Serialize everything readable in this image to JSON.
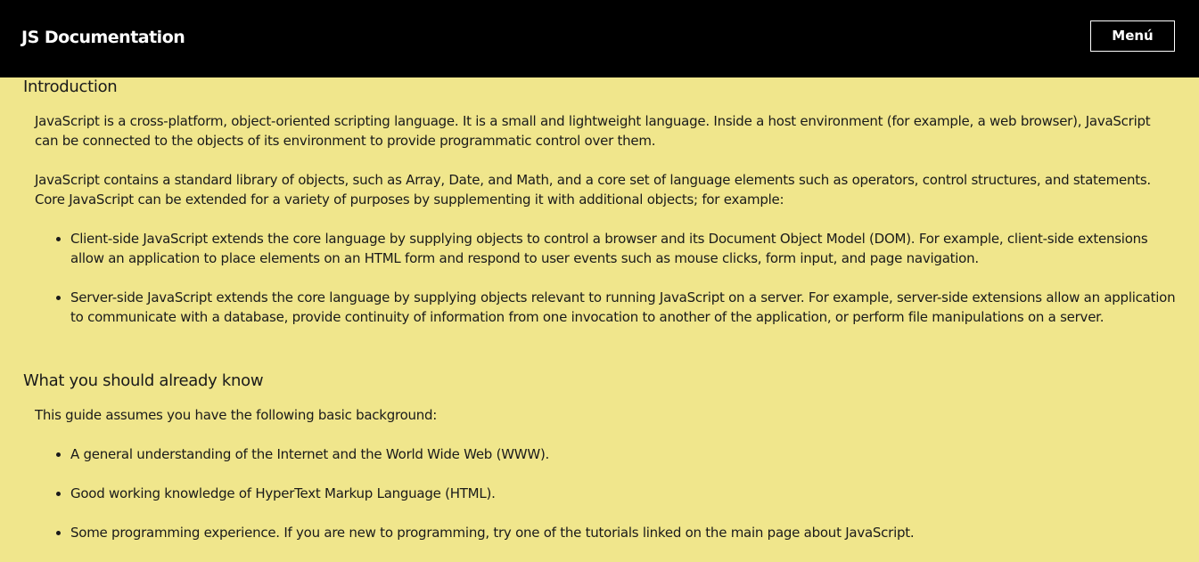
{
  "navbar": {
    "brand": "JS Documentation",
    "menu_label": "Menú"
  },
  "sections": {
    "introduction": {
      "heading": "Introduction",
      "paragraphs": [
        "JavaScript is a cross-platform, object-oriented scripting language. It is a small and lightweight language. Inside a host environment (for example, a web browser), JavaScript can be connected to the objects of its environment to provide programmatic control over them.",
        "JavaScript contains a standard library of objects, such as Array, Date, and Math, and a core set of language elements such as operators, control structures, and statements. Core JavaScript can be extended for a variety of purposes by supplementing it with additional objects; for example:"
      ],
      "list": [
        "Client-side JavaScript extends the core language by supplying objects to control a browser and its Document Object Model (DOM). For example, client-side extensions allow an application to place elements on an HTML form and respond to user events such as mouse clicks, form input, and page navigation.",
        "Server-side JavaScript extends the core language by supplying objects relevant to running JavaScript on a server. For example, server-side extensions allow an application to communicate with a database, provide continuity of information from one invocation to another of the application, or perform file manipulations on a server."
      ]
    },
    "prerequisites": {
      "heading": "What you should already know",
      "paragraphs": [
        "This guide assumes you have the following basic background:"
      ],
      "list": [
        "A general understanding of the Internet and the World Wide Web (WWW).",
        "Good working knowledge of HyperText Markup Language (HTML).",
        "Some programming experience. If you are new to programming, try one of the tutorials linked on the main page about JavaScript."
      ]
    }
  },
  "colors": {
    "background": "#f0e68c",
    "navbar": "#000000",
    "text": "#1a1a1a"
  }
}
